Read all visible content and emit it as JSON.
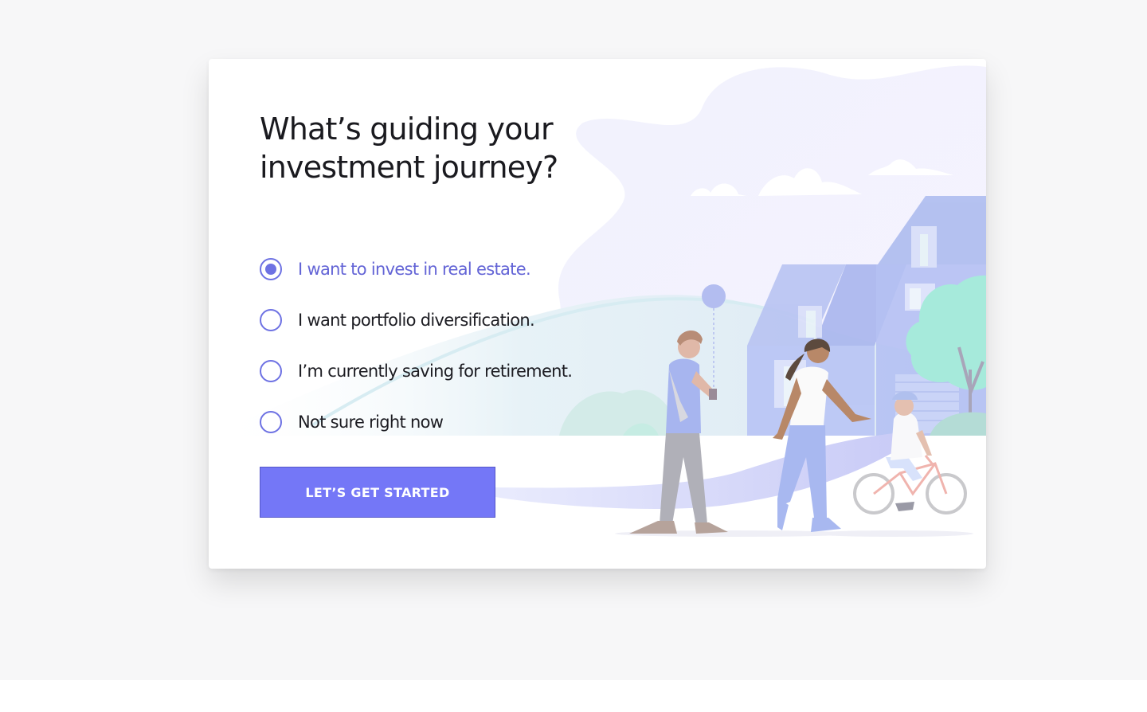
{
  "card": {
    "heading": "What’s guiding your investment journey?",
    "options": [
      {
        "label": "I want to invest in real estate.",
        "selected": true
      },
      {
        "label": "I want portfolio diversification.",
        "selected": false
      },
      {
        "label": "I’m currently saving for retirement.",
        "selected": false
      },
      {
        "label": "Not sure right now",
        "selected": false
      }
    ],
    "cta_label": "LET’S GET STARTED"
  },
  "theme": {
    "accent": "#7477f7",
    "selected_text": "#6364d6",
    "radio_border": "#6e72e3"
  }
}
